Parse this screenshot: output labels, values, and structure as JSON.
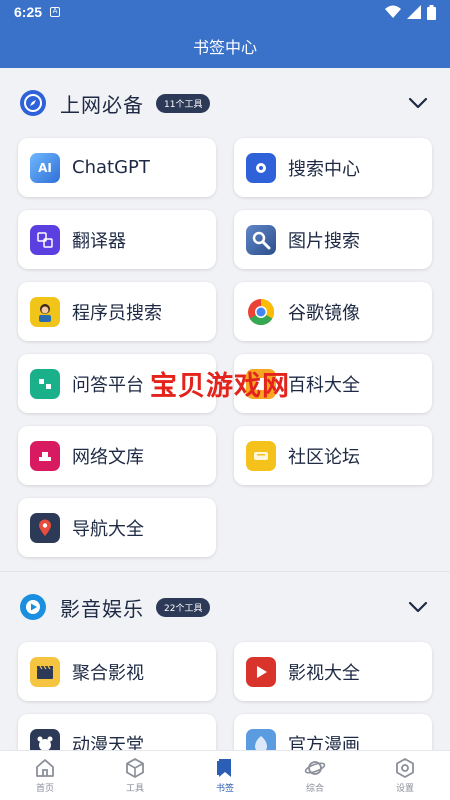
{
  "status": {
    "time": "6:25"
  },
  "header": {
    "title": "书签中心"
  },
  "sections": [
    {
      "title": "上网必备",
      "badge": "11个工具",
      "items": [
        {
          "label": "ChatGPT",
          "icon": "chatgpt-icon",
          "color": "#2f6fd6"
        },
        {
          "label": "搜索中心",
          "icon": "search-center-icon",
          "color": "#2f62d8"
        },
        {
          "label": "翻译器",
          "icon": "translate-icon",
          "color": "#5b3fe0"
        },
        {
          "label": "图片搜索",
          "icon": "image-search-icon",
          "color": "#3a5fa8"
        },
        {
          "label": "程序员搜索",
          "icon": "programmer-icon",
          "color": "#f0c419"
        },
        {
          "label": "谷歌镜像",
          "icon": "chrome-icon",
          "color": "#ea4335"
        },
        {
          "label": "问答平台",
          "icon": "qa-icon",
          "color": "#1ab08a"
        },
        {
          "label": "百科大全",
          "icon": "encyclopedia-icon",
          "color": "#f6a623"
        },
        {
          "label": "网络文库",
          "icon": "library-icon",
          "color": "#d81b60"
        },
        {
          "label": "社区论坛",
          "icon": "forum-icon",
          "color": "#f4c21a"
        },
        {
          "label": "导航大全",
          "icon": "navigation-icon",
          "color": "#2d3a57"
        }
      ]
    },
    {
      "title": "影音娱乐",
      "badge": "22个工具",
      "items": [
        {
          "label": "聚合影视",
          "icon": "clapper-icon",
          "color": "#f5c542"
        },
        {
          "label": "影视大全",
          "icon": "play-icon",
          "color": "#d9342b"
        },
        {
          "label": "动漫天堂",
          "icon": "anime-icon",
          "color": "#2d3a57"
        },
        {
          "label": "官方漫画",
          "icon": "comic-icon",
          "color": "#5b9be0"
        }
      ]
    }
  ],
  "watermark": "宝贝游戏网",
  "nav": [
    {
      "label": "首页",
      "icon": "home-icon"
    },
    {
      "label": "工具",
      "icon": "tools-icon"
    },
    {
      "label": "书签",
      "icon": "bookmark-icon",
      "active": true
    },
    {
      "label": "综合",
      "icon": "planet-icon"
    },
    {
      "label": "设置",
      "icon": "settings-icon"
    }
  ]
}
